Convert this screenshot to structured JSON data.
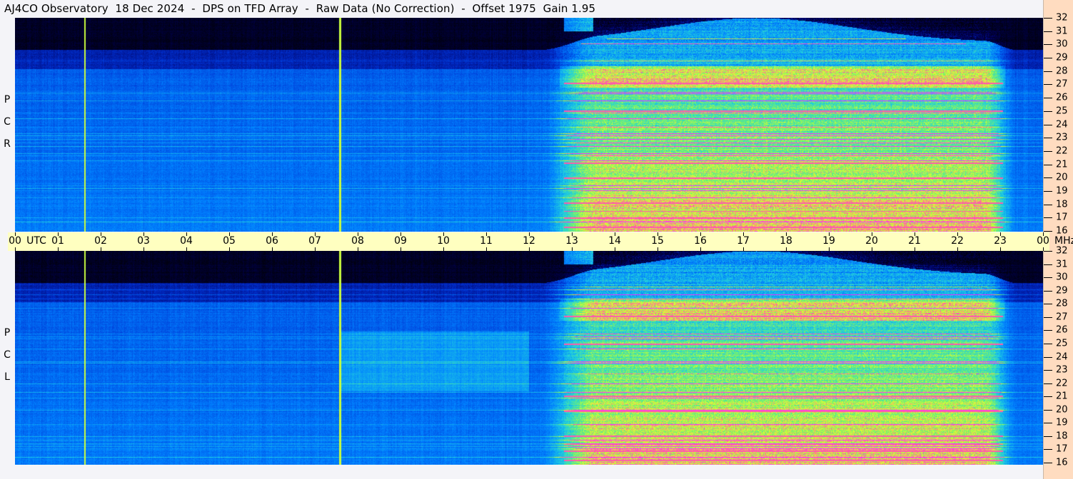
{
  "title": "AJ4CO Observatory  18 Dec 2024  -  DPS on TFD Array  -  Raw Data (No Correction)  -  Offset 1975  Gain 1.95",
  "panels": [
    {
      "label_letters": [
        "R",
        "C",
        "P"
      ]
    },
    {
      "label_letters": [
        "L",
        "C",
        "P"
      ]
    }
  ],
  "time_axis": {
    "ticks": [
      "00",
      "01",
      "02",
      "03",
      "04",
      "05",
      "06",
      "07",
      "08",
      "09",
      "10",
      "11",
      "12",
      "13",
      "14",
      "15",
      "16",
      "17",
      "18",
      "19",
      "20",
      "21",
      "22",
      "23",
      "00"
    ],
    "unit_label": "UTC"
  },
  "freq_axis": {
    "ticks": [
      "32",
      "31",
      "30",
      "29",
      "28",
      "27",
      "26",
      "25",
      "24",
      "23",
      "22",
      "21",
      "20",
      "19",
      "18",
      "17",
      "16"
    ],
    "unit_label": "MHz"
  },
  "colors": {
    "time_band": "#ffffc0",
    "freq_band": "#ffdcc0",
    "marker_line": "#c8ff40"
  },
  "chart_data": {
    "type": "heatmap",
    "title": "AJ4CO Observatory  18 Dec 2024  -  DPS on TFD Array  -  Raw Data (No Correction)  -  Offset 1975  Gain 1.95",
    "xlabel": "UTC",
    "ylabel": "MHz",
    "xlim": [
      0,
      24
    ],
    "ylim": [
      16,
      32
    ],
    "series": [
      {
        "name": "RCP"
      },
      {
        "name": "LCP"
      }
    ],
    "colormap": [
      "#000010",
      "#000060",
      "#0030d0",
      "#0080ff",
      "#20d0e0",
      "#70f070",
      "#e0ff30",
      "#ff60a0",
      "#ff30ff"
    ],
    "vertical_markers_utc": [
      1.62,
      7.58
    ],
    "grid": false
  }
}
